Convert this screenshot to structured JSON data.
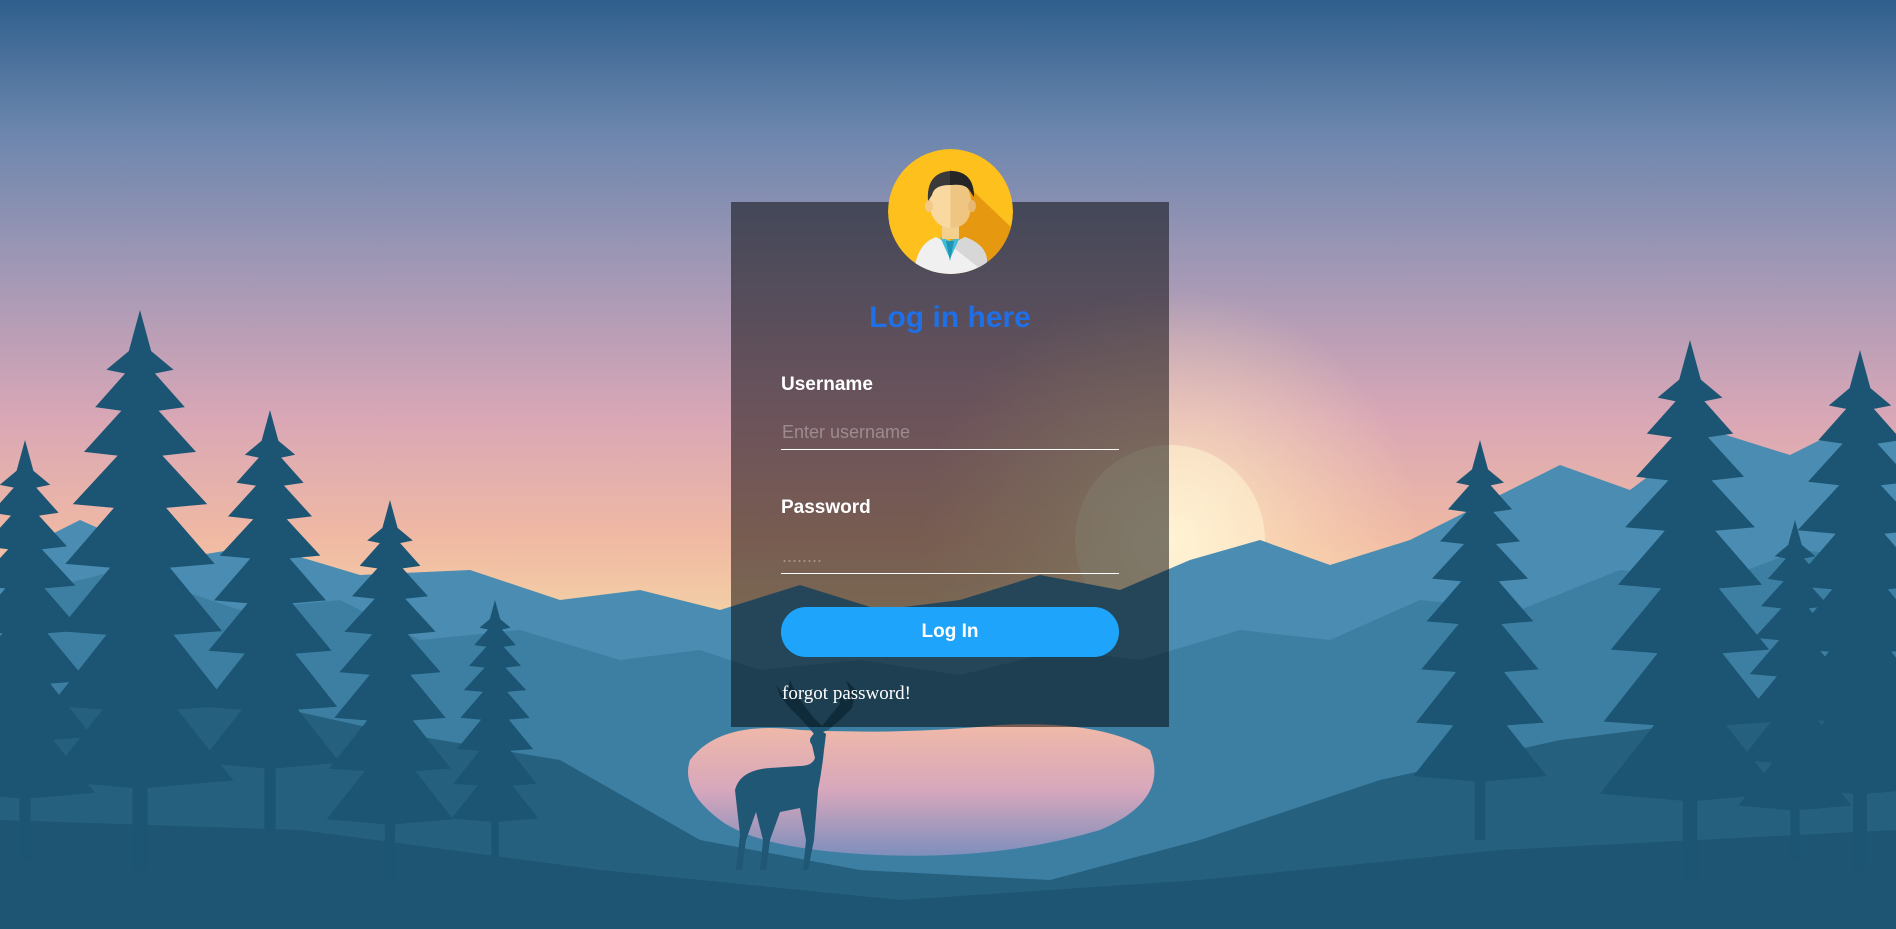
{
  "login": {
    "title": "Log in here",
    "username": {
      "label": "Username",
      "placeholder": "Enter username",
      "value": ""
    },
    "password": {
      "label": "Password",
      "placeholder": "........",
      "value": ""
    },
    "submit_label": "Log In",
    "forgot_label": "forgot password!"
  },
  "icons": {
    "avatar": "user-avatar-icon"
  },
  "colors": {
    "title": "#1f6fe6",
    "button": "#1ea5fb",
    "avatar_bg": "#fdc01c",
    "panel_overlay": "rgba(0,0,0,0.5)"
  }
}
